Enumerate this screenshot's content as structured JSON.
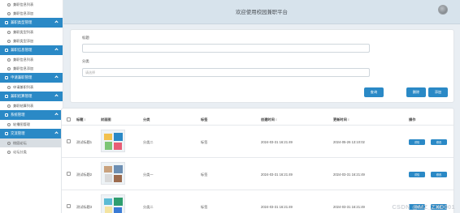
{
  "sidebar": {
    "items": [
      {
        "type": "sub",
        "label": "兼职信息列表"
      },
      {
        "type": "sub",
        "label": "兼职信息添加"
      },
      {
        "type": "head",
        "label": "兼职类型管理"
      },
      {
        "type": "sub",
        "label": "兼职类型列表"
      },
      {
        "type": "sub",
        "label": "兼职类型添加"
      },
      {
        "type": "head",
        "label": "兼职信息管理"
      },
      {
        "type": "sub",
        "label": "兼职信息列表"
      },
      {
        "type": "sub",
        "label": "兼职信息添加"
      },
      {
        "type": "head",
        "label": "申请兼职管理"
      },
      {
        "type": "sub",
        "label": "申请兼职列表"
      },
      {
        "type": "head",
        "label": "兼职结算管理"
      },
      {
        "type": "sub",
        "label": "兼职结算列表"
      },
      {
        "type": "head",
        "label": "系统管理"
      },
      {
        "type": "sub",
        "label": "轮播图管理"
      },
      {
        "type": "head",
        "label": "交流管理"
      },
      {
        "type": "sub",
        "label": "校园论坛",
        "active": true
      },
      {
        "type": "sub",
        "label": "论坛分类"
      }
    ]
  },
  "topbar": {
    "title": "欢迎使用校园兼职平台"
  },
  "search": {
    "title_label": "标题",
    "title_placeholder": "",
    "category_label": "分类",
    "category_placeholder": "请选择",
    "buttons": {
      "search": "查询",
      "delete": "删除",
      "add": "添加"
    }
  },
  "table": {
    "headers": {
      "title": "标题 ↕",
      "cover": "封面图",
      "category": "分类",
      "tag": "标签",
      "created": "创建时间 ↕",
      "updated": "更新时间 ↕",
      "actions": "操作"
    },
    "rows": [
      {
        "title": "测试标题1",
        "category": "分类二",
        "tag": "标签",
        "created": "2024-03-31 16:21:49",
        "updated": "2024-05-26 13:10:02",
        "btn_detail": "详情",
        "btn_edit": "修改"
      },
      {
        "title": "测试标题2",
        "category": "分类一",
        "tag": "标签",
        "created": "2024-03-31 16:21:49",
        "updated": "2024-03-31 16:21:49",
        "btn_detail": "详情",
        "btn_edit": "修改"
      },
      {
        "title": "测试标题3",
        "category": "分类二",
        "tag": "标签",
        "created": "2024-03-31 16:21:49",
        "updated": "2024-03-31 16:21:49",
        "btn_detail": "详情",
        "btn_edit": "修改"
      }
    ]
  },
  "watermark": "CSDN @MZ_ZXD001"
}
